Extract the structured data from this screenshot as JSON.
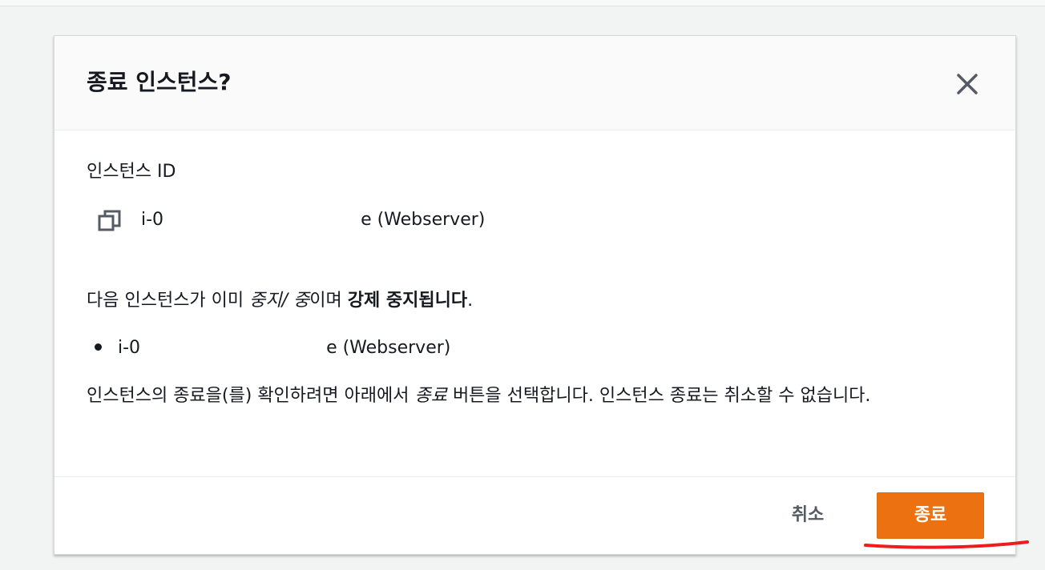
{
  "modal": {
    "title": "종료 인스턴스?",
    "close_icon": "close-icon",
    "field_label": "인스턴스 ID",
    "copy_icon": "copy-icon",
    "instance_id_prefix": "i-0",
    "instance_id_suffix": "e (Webserver)",
    "stopping_notice": {
      "prefix": "다음 인스턴스가 이미 ",
      "italic": "중지/ 중",
      "middle": "이며 ",
      "bold": "강제 중지됩니다",
      "end": "."
    },
    "stopping_instance_prefix": "i-0",
    "stopping_instance_suffix": "e (Webserver)",
    "confirm_text": {
      "prefix": "인스턴스의 종료을(를) 확인하려면 아래에서 ",
      "italic": "종료",
      "rest": " 버튼을 선택합니다. 인스턴스 종료는 취소할 수 없습니다."
    }
  },
  "footer": {
    "cancel_label": "취소",
    "terminate_label": "종료"
  },
  "colors": {
    "primary_button": "#ec7211",
    "annotation_underline": "#ee1c1c",
    "text": "#16191f",
    "cancel_text": "#545b64"
  }
}
